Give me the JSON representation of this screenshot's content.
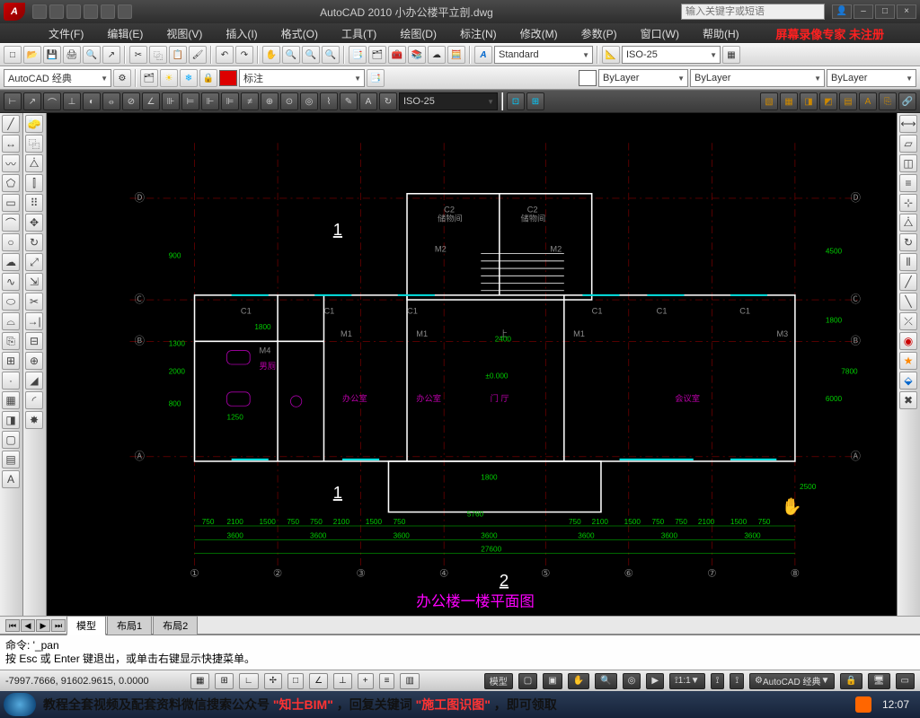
{
  "app": {
    "title": "AutoCAD 2010   小办公楼平立剖.dwg",
    "search_placeholder": "输入关键字或短语",
    "logo": "A"
  },
  "overlay_text": "屏幕录像专家 未注册",
  "menu": {
    "items": [
      "文件(F)",
      "编辑(E)",
      "视图(V)",
      "插入(I)",
      "格式(O)",
      "工具(T)",
      "绘图(D)",
      "标注(N)",
      "修改(M)",
      "参数(P)",
      "窗口(W)",
      "帮助(H)"
    ]
  },
  "row1": {
    "style": "Standard",
    "dimstyle": "ISO-25"
  },
  "row2": {
    "workspace": "AutoCAD 经典",
    "annot": "标注",
    "layer_state": "ByLayer",
    "layer_color": "#d00000",
    "line_bylayer": "ByLayer"
  },
  "row3": {
    "dimstyle": "ISO-25"
  },
  "canvas": {
    "drawing_title": "办公楼一楼平面图",
    "section_top": "1",
    "section_bot": "1",
    "sheet_bot": "2",
    "axis_x": [
      "①",
      "②",
      "③",
      "④",
      "⑤",
      "⑥",
      "⑦",
      "⑧"
    ],
    "axis_y": [
      "Ⓐ",
      "Ⓑ",
      "Ⓒ",
      "Ⓓ"
    ],
    "labels": {
      "c1": "C1",
      "c2": "C2",
      "m1": "M1",
      "m2": "M2",
      "m3": "M3",
      "m4": "M4",
      "chu": "储物间",
      "up": "上",
      "ban": "办公室",
      "ting": "门 厅",
      "hui": "会议室",
      "wc": "男厕",
      "zero": "±0.000"
    },
    "dims_bottom_run": [
      "750",
      "2100",
      "1500",
      "750",
      "750",
      "2100",
      "1500",
      "750",
      "750"
    ],
    "dims_bottom_bay": [
      "3600",
      "3600",
      "3600",
      "3600",
      "3600",
      "3600",
      "3600"
    ],
    "dims_bottom_total": "27600",
    "dims_right": [
      "4500",
      "1800",
      "7800",
      "6000"
    ],
    "dims_left": [
      "800",
      "1300",
      "2000",
      "800"
    ],
    "dims_other": {
      "d1250": "1250",
      "d1800": "1800",
      "d2400": "2400",
      "d5760": "5760",
      "d900": "900",
      "d2500": "2500",
      "d750": "750",
      "d2100": "2100",
      "d1500": "1500"
    }
  },
  "tabs": {
    "model": "模型",
    "layout1": "布局1",
    "layout2": "布局2"
  },
  "cmd": {
    "l1": "命令: '_pan",
    "l2": "按 Esc 或 Enter 键退出，或单击右键显示快捷菜单。"
  },
  "status": {
    "coords": "-7997.7666, 91602.9615, 0.0000",
    "model": "模型",
    "scale": "1:1",
    "ws": "AutoCAD 经典"
  },
  "taskbar": {
    "banner_black1": "教程全套视频及配套资料微信搜索公众号",
    "banner_red1": "\"知士BIM\"",
    "banner_black2": "，回复关键词",
    "banner_red2": "\"施工图识图\"",
    "banner_black3": "，即可领取",
    "clock": "12:07"
  }
}
